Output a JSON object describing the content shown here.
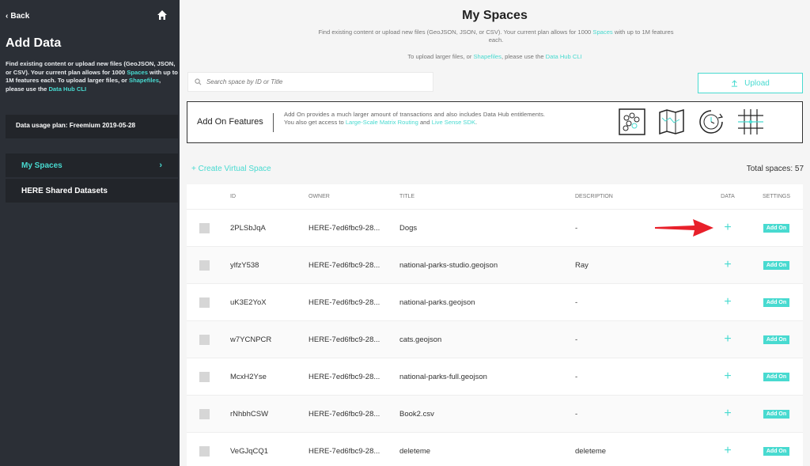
{
  "sidebar": {
    "back_label": "Back",
    "title": "Add Data",
    "desc_part1": "Find existing content or upload new files (GeoJSON, JSON, or CSV). Your current plan allows for 1000 ",
    "desc_link_spaces": "Spaces",
    "desc_part2": " with up to 1M features each. To upload larger files, or ",
    "desc_link_shapefiles": "Shapefiles",
    "desc_part3": ", please use the ",
    "desc_link_cli": "Data Hub CLI",
    "plan": "Data usage plan: Freemium 2019-05-28",
    "nav": [
      {
        "label": "My Spaces"
      },
      {
        "label": "HERE Shared Datasets"
      }
    ]
  },
  "main": {
    "title": "My Spaces",
    "sub_part1": "Find existing content or upload new files (GeoJSON, JSON, or CSV). Your current plan allows for 1000 ",
    "sub_link_spaces": "Spaces",
    "sub_part2": " with up to 1M features each.",
    "sub2_part1": "To upload larger files, or ",
    "sub2_link_shapefiles": "Shapefiles",
    "sub2_part2": ", please use the ",
    "sub2_link_cli": "Data Hub CLI",
    "search_placeholder": "Search space by ID or Title",
    "upload_label": "Upload",
    "addon": {
      "title": "Add On Features",
      "text_part1": "Add On provides a much larger amount of transactions and also includes Data Hub entitlements. You also get access to ",
      "text_link1": "Large-Scale Matrix Routing",
      "text_part2": " and ",
      "text_link2": "Live Sense SDK",
      "text_part3": "."
    },
    "create_label": "+ Create Virtual Space",
    "total_label": "Total spaces: 57",
    "table": {
      "headers": {
        "id": "ID",
        "owner": "OWNER",
        "title": "TITLE",
        "description": "DESCRIPTION",
        "data": "DATA",
        "settings": "SETTINGS"
      },
      "plus_symbol": "+",
      "rows": [
        {
          "id": "2PLSbJqA",
          "owner": "HERE-7ed6fbc9-28...",
          "title": "Dogs",
          "description": "-",
          "settings": "Add On"
        },
        {
          "id": "ylfzY538",
          "owner": "HERE-7ed6fbc9-28...",
          "title": "national-parks-studio.geojson",
          "description": "Ray",
          "settings": "Add On"
        },
        {
          "id": "uK3E2YoX",
          "owner": "HERE-7ed6fbc9-28...",
          "title": "national-parks.geojson",
          "description": "-",
          "settings": "Add On"
        },
        {
          "id": "w7YCNPCR",
          "owner": "HERE-7ed6fbc9-28...",
          "title": "cats.geojson",
          "description": "-",
          "settings": "Add On"
        },
        {
          "id": "McxH2Yse",
          "owner": "HERE-7ed6fbc9-28...",
          "title": "national-parks-full.geojson",
          "description": "-",
          "settings": "Add On"
        },
        {
          "id": "rNhbhCSW",
          "owner": "HERE-7ed6fbc9-28...",
          "title": "Book2.csv",
          "description": "-",
          "settings": "Add On"
        },
        {
          "id": "VeGJqCQ1",
          "owner": "HERE-7ed6fbc9-28...",
          "title": "deleteme",
          "description": "deleteme",
          "settings": "Add On"
        }
      ]
    }
  },
  "colors": {
    "accent": "#48dad0",
    "sidebar_bg": "#2b2f36",
    "sidebar_panel": "#22252a",
    "arrow": "#e8202a"
  }
}
